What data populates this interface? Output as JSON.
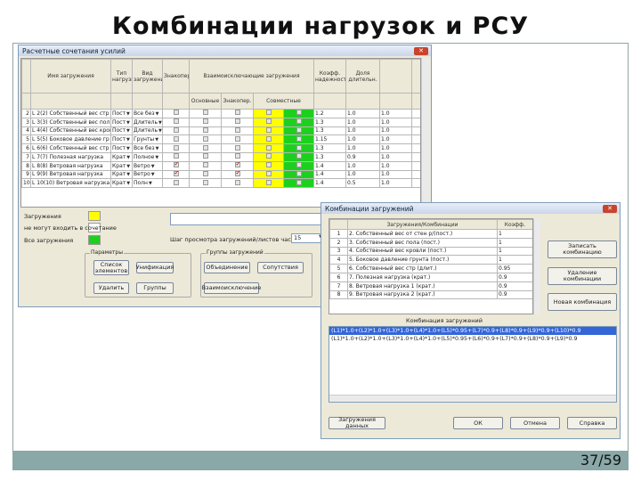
{
  "slide": {
    "title": "Комбинации нагрузок и РСУ",
    "page": "37/59"
  },
  "win1": {
    "title": "Расчетные сочетания усилий",
    "headers": {
      "name": "Имя загружения",
      "type_load": "Тип нагрузки",
      "kind": "Вид загружения",
      "sign": "Знакопеременн.",
      "mutual": "Взаимоисключающие загружения",
      "basic": "Основные",
      "seismic": "Знакопер.",
      "together": "Совместные",
      "coef": "Коэфф. надежности",
      "other": "Доля длительн."
    },
    "rows": [
      {
        "n": "2",
        "name": "L 2(2) Собственный вес стр",
        "t": "Пост",
        "k": "Все без",
        "sign": false,
        "m1": false,
        "m2": false,
        "c": "1.2",
        "d": "1.0",
        "e": "1.0"
      },
      {
        "n": "3",
        "name": "L 3(3) Собственный вес пол",
        "t": "Пост",
        "k": "Длитель",
        "sign": false,
        "m1": false,
        "m2": false,
        "c": "1.3",
        "d": "1.0",
        "e": "1.0"
      },
      {
        "n": "4",
        "name": "L 4(4) Собственный вес кров",
        "t": "Пост",
        "k": "Длитель",
        "sign": false,
        "m1": false,
        "m2": false,
        "c": "1.3",
        "d": "1.0",
        "e": "1.0"
      },
      {
        "n": "5",
        "name": "L 5(5) Боковое давление гр",
        "t": "Пост",
        "k": "Грунты",
        "sign": false,
        "m1": false,
        "m2": false,
        "c": "1.15",
        "d": "1.0",
        "e": "1.0"
      },
      {
        "n": "6",
        "name": "L 6(6) Собственный вес стр",
        "t": "Пост",
        "k": "Все без",
        "sign": false,
        "m1": false,
        "m2": false,
        "c": "1.3",
        "d": "1.0",
        "e": "1.0"
      },
      {
        "n": "7",
        "name": "L 7(7) Полезная нагрузка",
        "t": "Крат",
        "k": "Полное",
        "sign": false,
        "m1": false,
        "m2": false,
        "c": "1.3",
        "d": "0.9",
        "e": "1.0"
      },
      {
        "n": "8",
        "name": "L 8(8) Ветровая нагрузка",
        "t": "Крат",
        "k": "Ветро",
        "sign": true,
        "m1": false,
        "m2": true,
        "c": "1.4",
        "d": "1.0",
        "e": "1.0"
      },
      {
        "n": "9",
        "name": "L 9(9) Ветровая нагрузка",
        "t": "Крат",
        "k": "Ветро",
        "sign": true,
        "m1": false,
        "m2": true,
        "c": "1.4",
        "d": "1.0",
        "e": "1.0"
      },
      {
        "n": "10",
        "name": "L 10(10) Ветровая нагрузка",
        "t": "Крат",
        "k": "Полн",
        "sign": false,
        "m1": false,
        "m2": false,
        "c": "1.4",
        "d": "0.5",
        "e": "1.0"
      }
    ],
    "legend": {
      "yellow": "Загружения",
      "white": "не могут входить в сочетание",
      "green": "Все загружения"
    },
    "scroll_label": "Шаг просмотра загружений/листов части:",
    "scroll_value": "15",
    "params": {
      "legend": "Параметры",
      "b1": "Список элементов",
      "b2": "Унификация",
      "b3": "Удалить",
      "b4": "Группы"
    },
    "groups": {
      "legend": "Группы загружений",
      "b1": "Объединение",
      "b2": "Сопутствия",
      "b3": "Взаимоисключение"
    }
  },
  "win2": {
    "title": "Комбинации загружений",
    "headers": {
      "name": "Загружения/Комбинации",
      "coef": "Коэфф."
    },
    "rows": [
      {
        "n": "1",
        "name": "2. Собственный вес от стен р/(пост.)",
        "c": "1"
      },
      {
        "n": "2",
        "name": "3. Собственный вес пола (пост.)",
        "c": "1"
      },
      {
        "n": "3",
        "name": "4. Собственный вес кровли (пост.)",
        "c": "1"
      },
      {
        "n": "4",
        "name": "5. Боковое давление грунта (пост.)",
        "c": "1"
      },
      {
        "n": "5",
        "name": "6. Собственный вес стр (длит.)",
        "c": "0.95"
      },
      {
        "n": "6",
        "name": "7. Полезная нагрузка (крат.)",
        "c": "0.9"
      },
      {
        "n": "7",
        "name": "8. Ветровая нагрузка 1 (крат.)",
        "c": "0.9"
      },
      {
        "n": "8",
        "name": "9. Ветровая нагрузка 2 (крат.)",
        "c": "0.9"
      }
    ],
    "buttons": {
      "add": "Записать комбинацию",
      "delete": "Удаление комбинации",
      "new": "Новая комбинация"
    },
    "combo_label": "Комбинация загружений",
    "combos": [
      "(L1)*1.0+(L2)*1.0+(L3)*1.0+(L4)*1.0+(L5)*0.95+(L7)*0.9+(L8)*0.9+(L9)*0.9+(L10)*0.9",
      "(L1)*1.0+(L2)*1.0+(L3)*1.0+(L4)*1.0+(L5)*0.95+(L6)*0.9+(L7)*0.9+(L8)*0.9+(L9)*0.9"
    ],
    "footer": {
      "view": "Загружения данных",
      "ok": "ОК",
      "cancel": "Отмена",
      "help": "Справка"
    }
  }
}
